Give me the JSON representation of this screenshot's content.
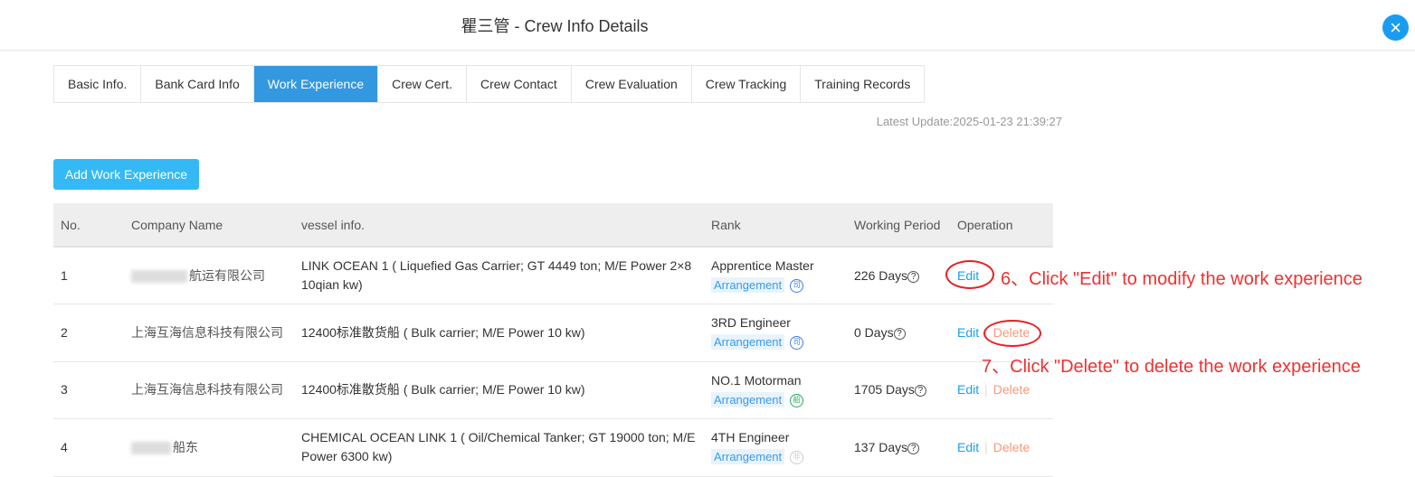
{
  "header": {
    "title": "瞿三管 - Crew Info Details",
    "close_icon": "close-icon"
  },
  "tabs": [
    {
      "label": "Basic Info."
    },
    {
      "label": "Bank Card Info"
    },
    {
      "label": "Work Experience",
      "active": true
    },
    {
      "label": "Crew Cert."
    },
    {
      "label": "Crew Contact"
    },
    {
      "label": "Crew Evaluation"
    },
    {
      "label": "Crew Tracking"
    },
    {
      "label": "Training Records"
    }
  ],
  "latest_update": "Latest Update:2025-01-23 21:39:27",
  "add_button": "Add Work Experience",
  "table": {
    "columns": [
      "No.",
      "Company Name",
      "vessel info.",
      "Rank",
      "Working Period",
      "Operation"
    ],
    "rows": [
      {
        "no": "1",
        "company": "航运有限公司",
        "company_blurred": true,
        "vessel": "LINK OCEAN 1 ( Liquefied Gas Carrier; GT 4449 ton; M/E Power 2×8 10qian kw)",
        "rank": "Apprentice Master",
        "tag": "Arrangement",
        "icon": "司",
        "period": "226 Days",
        "edit": "Edit",
        "delete": ""
      },
      {
        "no": "2",
        "company": "上海互海信息科技有限公司",
        "vessel": "12400标准散货船 ( Bulk carrier; M/E Power 10 kw)",
        "rank": "3RD Engineer",
        "tag": "Arrangement",
        "icon": "司",
        "period": "0 Days",
        "edit": "Edit",
        "delete": "Delete"
      },
      {
        "no": "3",
        "company": "上海互海信息科技有限公司",
        "vessel": "12400标准散货船 ( Bulk carrier; M/E Power 10 kw)",
        "rank": "NO.1 Motorman",
        "tag": "Arrangement",
        "icon": "船",
        "period": "1705 Days",
        "edit": "Edit",
        "delete": "Delete"
      },
      {
        "no": "4",
        "company": "船东",
        "company_blurred": true,
        "vessel": "CHEMICAL OCEAN LINK 1 ( Oil/Chemical Tanker; GT 19000 ton; M/E Power 6300 kw)",
        "rank": "4TH Engineer",
        "tag": "Arrangement",
        "icon": "非",
        "period": "137 Days",
        "edit": "Edit",
        "delete": "Delete"
      }
    ]
  },
  "annotations": [
    "6、Click \"Edit\" to modify the work experience",
    "7、Click \"Delete\" to delete the work experience"
  ],
  "colors": {
    "accent": "#3498e0",
    "edit": "#1aa0f0",
    "delete": "#f59a7a",
    "annotation": "#f03030"
  }
}
